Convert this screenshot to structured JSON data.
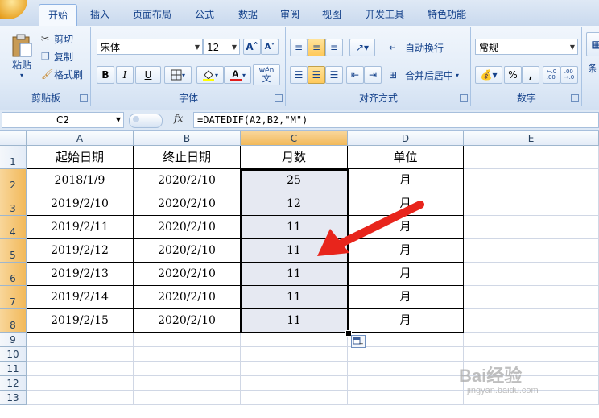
{
  "tabs": [
    "开始",
    "插入",
    "页面布局",
    "公式",
    "数据",
    "审阅",
    "视图",
    "开发工具",
    "特色功能"
  ],
  "active_tab": "开始",
  "clipboard": {
    "paste": "粘贴",
    "cut": "剪切",
    "copy": "复制",
    "format_painter": "格式刷",
    "group": "剪贴板"
  },
  "font": {
    "name": "宋体",
    "size": "12",
    "group": "字体",
    "bold": "B",
    "italic": "I",
    "underline": "U",
    "wen": "wén"
  },
  "alignment": {
    "wrap": "自动换行",
    "merge": "合并后居中",
    "group": "对齐方式"
  },
  "number": {
    "format": "常规",
    "percent": "%",
    "comma": ",",
    "group": "数字",
    "inc": "+.0 .00",
    "dec": ".00 →.0"
  },
  "styles": {
    "partial": "条"
  },
  "formula_bar": {
    "name_box": "C2",
    "fx": "fx",
    "formula": "=DATEDIF(A2,B2,\"M\")"
  },
  "columns": [
    "A",
    "B",
    "C",
    "D",
    "E"
  ],
  "rows": [
    "1",
    "2",
    "3",
    "4",
    "5",
    "6",
    "7",
    "8",
    "9",
    "10",
    "11",
    "12",
    "13"
  ],
  "table": {
    "headers": [
      "起始日期",
      "终止日期",
      "月数",
      "单位"
    ],
    "rows": [
      [
        "2018/1/9",
        "2020/2/10",
        "25",
        "月"
      ],
      [
        "2019/2/10",
        "2020/2/10",
        "12",
        "月"
      ],
      [
        "2019/2/11",
        "2020/2/10",
        "11",
        "月"
      ],
      [
        "2019/2/12",
        "2020/2/10",
        "11",
        "月"
      ],
      [
        "2019/2/13",
        "2020/2/10",
        "11",
        "月"
      ],
      [
        "2019/2/14",
        "2020/2/10",
        "11",
        "月"
      ],
      [
        "2019/2/15",
        "2020/2/10",
        "11",
        "月"
      ]
    ]
  },
  "watermark": {
    "text": "Bai经验",
    "url": "jingyan.baidu.com"
  },
  "colors": {
    "arrow": "#e8251c",
    "selection": "#e6e9f2",
    "header_selected": "#f2b95a"
  }
}
